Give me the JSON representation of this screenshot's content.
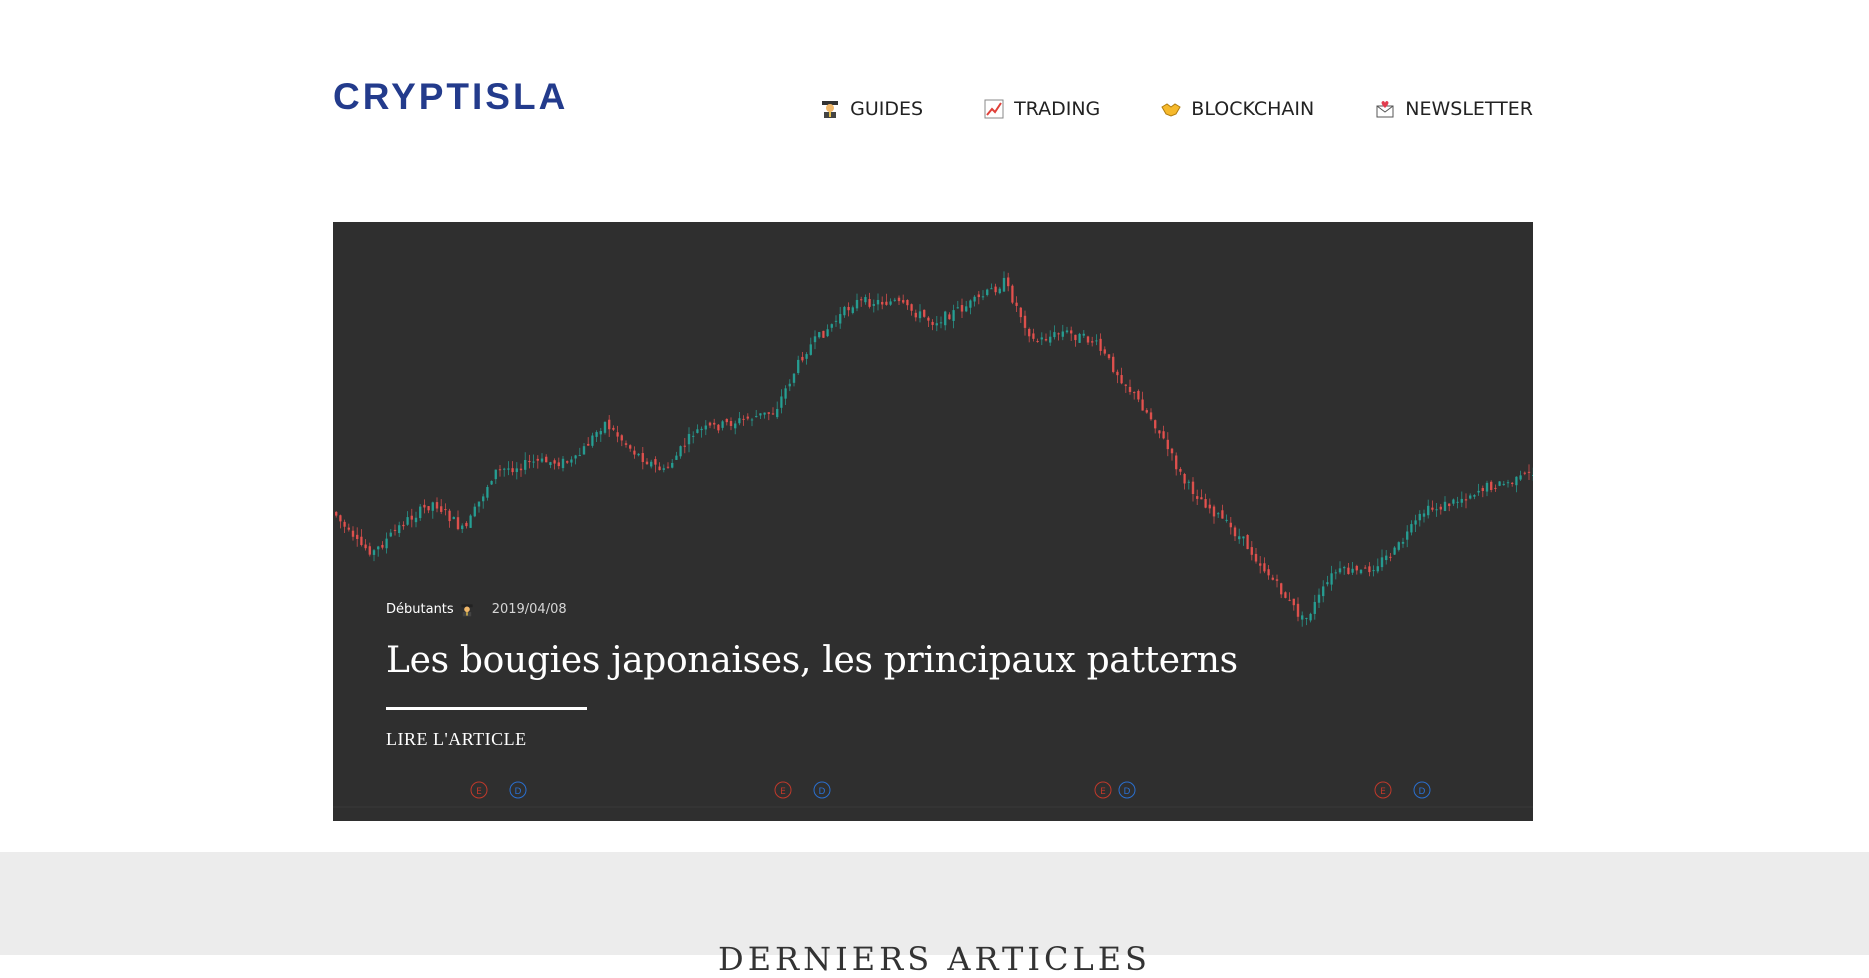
{
  "header": {
    "logo": "CRYPTISLA",
    "nav": [
      {
        "label": "GUIDES",
        "icon": "graduate-emoji-icon"
      },
      {
        "label": "TRADING",
        "icon": "chart-increasing-emoji-icon"
      },
      {
        "label": "BLOCKCHAIN",
        "icon": "handshake-emoji-icon"
      },
      {
        "label": "NEWSLETTER",
        "icon": "envelope-heart-emoji-icon"
      }
    ]
  },
  "hero": {
    "category": "Débutants",
    "category_icon": "graduate-emoji-icon",
    "date": "2019/04/08",
    "title": "Les bougies japonaises, les principaux patterns",
    "cta": "LIRE L'ARTICLE",
    "background_chart": {
      "type": "candlestick",
      "up_color": "#26a69a",
      "down_color": "#ef5350",
      "event_markers": [
        "E",
        "D",
        "E",
        "D",
        "E",
        "D",
        "E",
        "D"
      ]
    }
  },
  "latest": {
    "title": "DERNIERS ARTICLES"
  },
  "colors": {
    "brand": "#233b8c",
    "hero_bg": "#2f2f2f",
    "latest_bg": "#ececec"
  }
}
